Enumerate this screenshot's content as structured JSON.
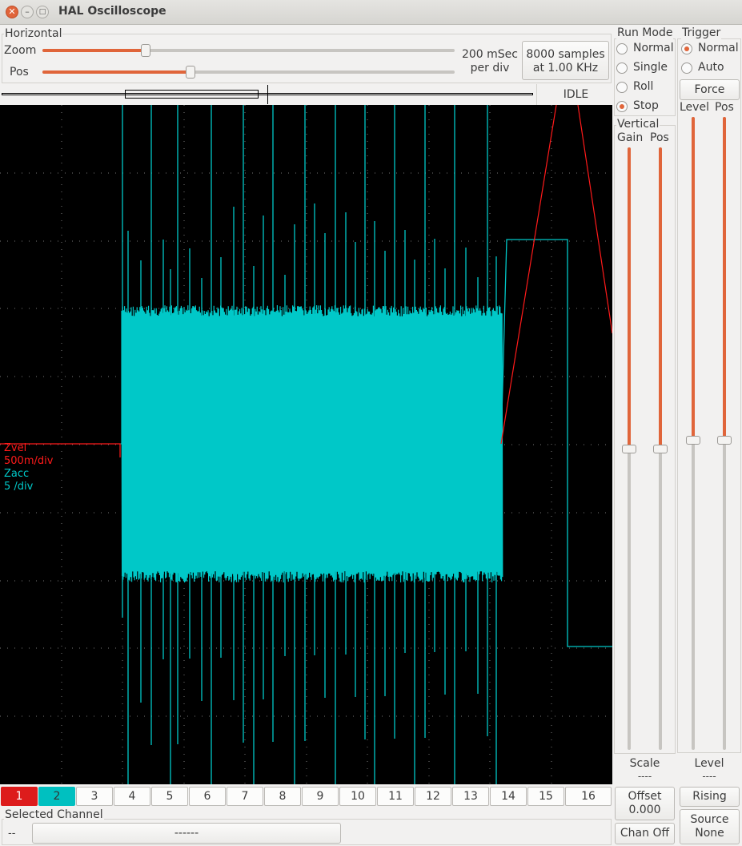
{
  "window": {
    "title": "HAL Oscilloscope"
  },
  "horizontal": {
    "label": "Horizontal",
    "zoom_label": "Zoom",
    "pos_label": "Pos",
    "zoom_level": 0.25,
    "pos_level": 0.36,
    "time_per_div_line1": "200 mSec",
    "time_per_div_line2": "per div",
    "samples_line1": "8000 samples",
    "samples_line2": "at 1.00 KHz",
    "status": "IDLE"
  },
  "run_mode": {
    "label": "Run Mode",
    "options": [
      "Normal",
      "Single",
      "Roll",
      "Stop"
    ],
    "selected": "Stop"
  },
  "trigger": {
    "label": "Trigger",
    "options": [
      "Normal",
      "Auto"
    ],
    "selected": "Normal",
    "force_label": "Force",
    "level_label": "Level",
    "pos_label": "Pos",
    "level_value": 0.51,
    "pos_value": 0.51,
    "bottom_level_label": "Level",
    "bottom_level_value": "----",
    "edge_label": "Rising",
    "source_line1": "Source",
    "source_line2": "None"
  },
  "vertical": {
    "label": "Vertical",
    "gain_label": "Gain",
    "pos_label": "Pos",
    "gain_value": 0.5,
    "pos_value": 0.5,
    "scale_label": "Scale",
    "scale_value": "----",
    "offset_line1": "Offset",
    "offset_line2": "0.000",
    "chan_off_label": "Chan Off"
  },
  "traces": [
    {
      "name": "Zvel",
      "scale": "500m/div",
      "color": "#ff1a1a"
    },
    {
      "name": "Zacc",
      "scale": "5 /div",
      "color": "#00c8c8"
    }
  ],
  "channels": [
    "1",
    "2",
    "3",
    "4",
    "5",
    "6",
    "7",
    "8",
    "9",
    "10",
    "11",
    "12",
    "13",
    "14",
    "15",
    "16"
  ],
  "active_channels": {
    "1": "#dd1c1c",
    "2": "#00c0c0"
  },
  "selected_channel": {
    "label": "Selected Channel",
    "prefix": "--",
    "value": "------"
  },
  "colors": {
    "accent": "#e0653a",
    "trace1": "#ff1a1a",
    "trace2": "#00c8c8",
    "screen": "#000000"
  }
}
